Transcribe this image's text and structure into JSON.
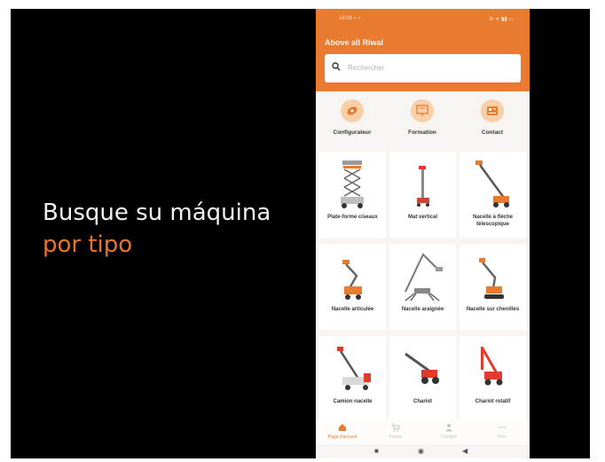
{
  "promo": {
    "line1": "Busque su máquina",
    "line2": "por tipo"
  },
  "status_bar": {
    "time": "14:09 ▪ ✓",
    "icons": "⊘ ᯤ ▮▮ ▭"
  },
  "app": {
    "title": "Above all Riwal",
    "search_placeholder": "Rechercher"
  },
  "shortcuts": [
    {
      "label": "Configurateur",
      "icon": "compass-icon"
    },
    {
      "label": "Formation",
      "icon": "training-icon"
    },
    {
      "label": "Contact",
      "icon": "contact-card-icon"
    }
  ],
  "machines": [
    {
      "label": "Plate-forme ciseaux"
    },
    {
      "label": "Mat vertical"
    },
    {
      "label": "Nacelle à flèche télescopique"
    },
    {
      "label": "Nacelle articulée"
    },
    {
      "label": "Nacelle araignée"
    },
    {
      "label": "Nacelle sur chenilles"
    },
    {
      "label": "Camion nacelle"
    },
    {
      "label": "Chariot"
    },
    {
      "label": "Chariot rotatif"
    }
  ],
  "bottom_nav": [
    {
      "label": "Page d'accueil",
      "icon": "home-icon",
      "active": true
    },
    {
      "label": "Panier",
      "icon": "cart-icon"
    },
    {
      "label": "Compte",
      "icon": "user-icon"
    },
    {
      "label": "Plus",
      "icon": "more-icon"
    }
  ],
  "system_nav": {
    "recents": "■",
    "home": "◉",
    "back": "◀"
  },
  "colors": {
    "accent": "#e97b31",
    "promo_highlight": "#e8742c",
    "background": "#000000"
  }
}
